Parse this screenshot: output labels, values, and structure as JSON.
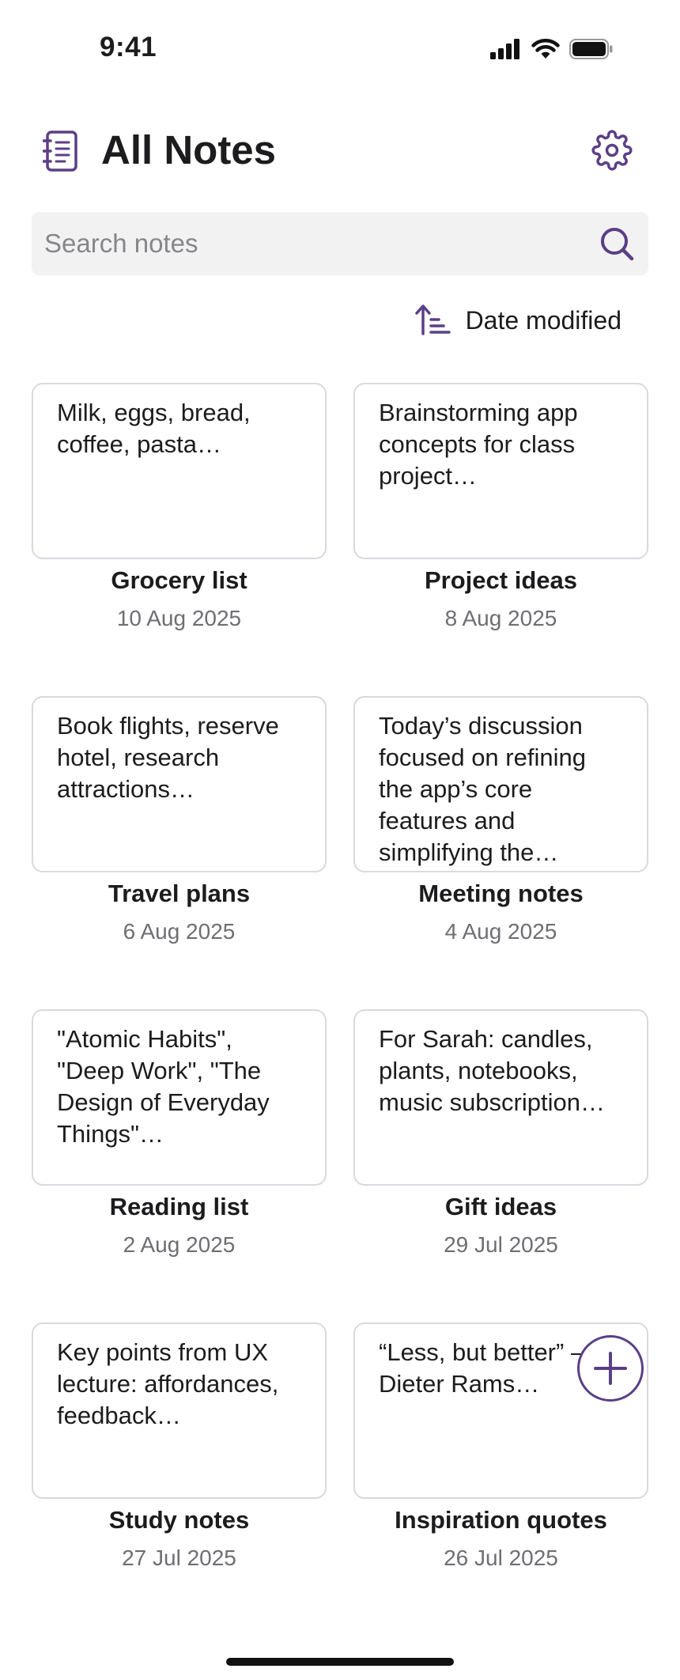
{
  "status_bar": {
    "time": "9:41"
  },
  "header": {
    "title": "All Notes"
  },
  "search": {
    "placeholder": "Search notes"
  },
  "sort": {
    "label": "Date modified"
  },
  "notes": [
    {
      "preview": "Milk, eggs, bread, coffee, pasta…",
      "title": "Grocery list",
      "date": "10 Aug 2025"
    },
    {
      "preview": "Brainstorming app concepts for class project…",
      "title": "Project ideas",
      "date": "8 Aug 2025"
    },
    {
      "preview": "Book flights, reserve hotel, research attractions…",
      "title": "Travel plans",
      "date": "6 Aug 2025"
    },
    {
      "preview": "Today’s discussion focused on refining the app’s core features and simplifying the…",
      "title": "Meeting notes",
      "date": "4 Aug 2025"
    },
    {
      "preview": "\"Atomic Habits\", \"Deep Work\", \"The Design of Everyday Things\"…",
      "title": "Reading list",
      "date": "2 Aug 2025"
    },
    {
      "preview": "For Sarah: candles, plants, notebooks, music subscription…",
      "title": "Gift ideas",
      "date": "29 Jul 2025"
    },
    {
      "preview": "Key points from UX lecture: affordances, feedback…",
      "title": "Study notes",
      "date": "27 Jul 2025"
    },
    {
      "preview": "“Less, but better” – Dieter Rams…",
      "title": "Inspiration quotes",
      "date": "26 Jul 2025"
    }
  ],
  "icons": {
    "notebook": "notebook-icon",
    "settings": "gear-icon",
    "search": "search-icon",
    "sort": "sort-ascending-icon",
    "add": "plus-icon"
  },
  "colors": {
    "accent": "#5b3f86",
    "card_border": "#d9d9de",
    "search_bg": "#f2f2f3",
    "muted_text": "#6e6e73"
  }
}
